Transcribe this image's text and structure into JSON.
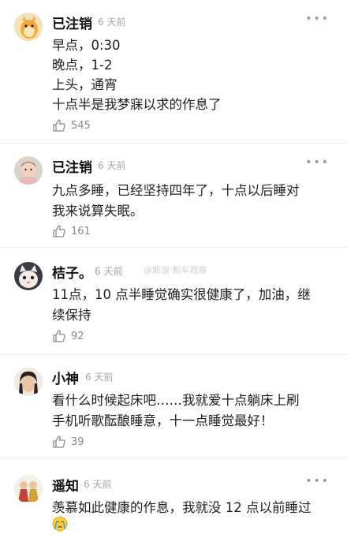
{
  "comments": [
    {
      "name": "已注销",
      "time": "6 天前",
      "lines": [
        "早点，0:30",
        "晚点，1-2",
        "上头，通宵",
        "十点半是我梦寐以求的作息了"
      ],
      "likes": "545"
    },
    {
      "name": "已注销",
      "time": "6 天前",
      "lines": [
        "九点多睡，已经坚持四年了，十点以后睡对",
        "我来说算失眠。"
      ],
      "likes": "161"
    },
    {
      "name": "桔子。",
      "time": "6 天前",
      "lines": [
        "11点，10 点半睡觉确实很健康了，加油，继",
        "续保持"
      ],
      "likes": "92"
    },
    {
      "name": "小神",
      "time": "6 天前",
      "lines": [
        "看什么时候起床吧……我就爱十点躺床上刷",
        "手机听歌酝酿睡意，十一点睡觉最好！"
      ],
      "likes": "39"
    },
    {
      "name": "遥知",
      "time": "6 天前",
      "lines": [
        "羡慕如此健康的作息，我就没 12 点以前睡过"
      ],
      "likes": ""
    }
  ],
  "more_glyph": "•••",
  "watermark": "@新浪·新车观察",
  "icons": {
    "like": "thumbs-up-icon",
    "more": "more-dots-icon",
    "emoji": "crying-face-icon"
  }
}
